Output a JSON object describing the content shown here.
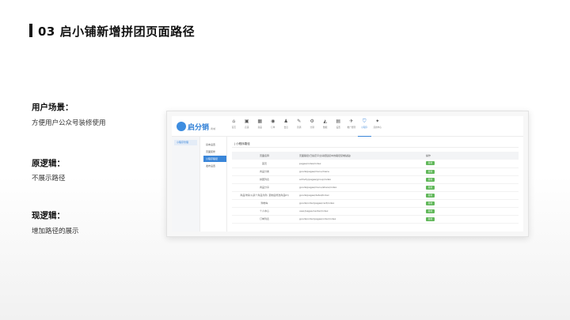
{
  "slide": {
    "title": "03 启小铺新增拼团页面路径",
    "sections": [
      {
        "heading": "用户场景：",
        "text": "方便用户公众号装修使用"
      },
      {
        "heading": "原逻辑：",
        "text": "不展示路径"
      },
      {
        "heading": "现逻辑：",
        "text": "增加路径的展示"
      }
    ]
  },
  "screenshot": {
    "logo_text": "启分销",
    "logo_sub": "商城",
    "nav": [
      {
        "icon": "⌂",
        "icon_name": "home-icon",
        "label": "首页"
      },
      {
        "icon": "▣",
        "icon_name": "shop-icon",
        "label": "店铺"
      },
      {
        "icon": "▦",
        "icon_name": "goods-icon",
        "label": "商品"
      },
      {
        "icon": "◉",
        "icon_name": "order-icon",
        "label": "订单"
      },
      {
        "icon": "♟",
        "icon_name": "member-icon",
        "label": "会员"
      },
      {
        "icon": "✎",
        "icon_name": "marketing-icon",
        "label": "营销"
      },
      {
        "icon": "⚙",
        "icon_name": "distribution-icon",
        "label": "分销"
      },
      {
        "icon": "◭",
        "icon_name": "data-icon",
        "label": "数据"
      },
      {
        "icon": "▤",
        "icon_name": "settings-icon",
        "label": "设置"
      },
      {
        "icon": "✈",
        "icon_name": "promote-icon",
        "label": "推广管理"
      },
      {
        "icon": "⛉",
        "icon_name": "miniprogram-icon",
        "label": "小程序"
      },
      {
        "icon": "✦",
        "icon_name": "apps-icon",
        "label": "应用中心"
      }
    ],
    "sidebar1": [
      "小程序管理"
    ],
    "sidebar2": [
      "基本设置",
      "页面装修",
      "小程序路径",
      "发布设置"
    ],
    "active_sidebar2_index": 2,
    "content_title": "| 小程序路径",
    "table": {
      "headers": [
        "页面名称",
        "页面路径(已指定平台请把链接中的路径复制粘贴)",
        "操作"
      ],
      "rows": [
        {
          "name": "首页",
          "path": "pages/index/index",
          "action": "复制"
        },
        {
          "name": "商品分类",
          "path": "goods/pages/menu/menu",
          "action": "复制"
        },
        {
          "name": "拼团列表",
          "path": "activity/pages/group/index",
          "action": "复制"
        },
        {
          "name": "商品分享",
          "path": "goods/pages/menu/share/index",
          "action": "复制"
        },
        {
          "name": "商品详情(以某个商品为例, 复制后修改商品ID)",
          "path": "goods/pages/detail/index",
          "action": "复制"
        },
        {
          "name": "购物车",
          "path": "goods/order/pages/cart/index",
          "action": "复制"
        },
        {
          "name": "个人中心",
          "path": "user/pages/center/index",
          "action": "复制"
        },
        {
          "name": "订单列表",
          "path": "goods/order/pages/order/index",
          "action": "复制"
        }
      ]
    }
  }
}
